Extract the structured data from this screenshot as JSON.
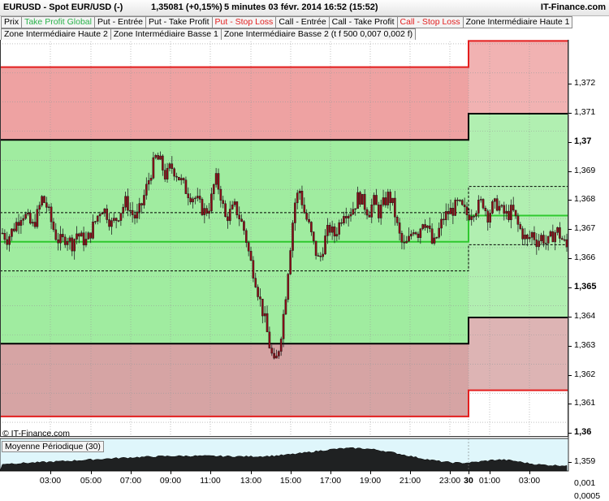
{
  "header": {
    "instrument": "EURUSD - Spot EUR/USD (-)",
    "last": "1,35081 (+0,15%)",
    "period": "5 minutes  03 févr. 2014 16:52 (15:52)",
    "brand": "IT-Finance.com"
  },
  "tabs_row1": [
    {
      "label": "Prix",
      "color": "normal"
    },
    {
      "label": "Take Profit Global",
      "color": "green"
    },
    {
      "label": "Put - Entrée",
      "color": "normal"
    },
    {
      "label": "Put - Take Profit",
      "color": "normal"
    },
    {
      "label": "Put - Stop Loss",
      "color": "red"
    },
    {
      "label": "Call - Entrée",
      "color": "normal"
    },
    {
      "label": "Call - Take Profit",
      "color": "normal"
    },
    {
      "label": "Call - Stop Loss",
      "color": "red"
    },
    {
      "label": "Zone Intermédiaire Haute 1",
      "color": "normal"
    }
  ],
  "tabs_row2": [
    {
      "label": "Zone Intermédiaire Haute 2",
      "color": "normal"
    },
    {
      "label": "Zone Intermédiaire Basse 1",
      "color": "normal"
    },
    {
      "label": "Zone Intermédiaire Basse 2 (t f 500 0,007 0,002 f)",
      "color": "normal"
    }
  ],
  "copyright": "© IT-Finance.com",
  "oscillator": {
    "title": "Moyenne Périodique (30)"
  },
  "colors": {
    "red_zone": "#eea2a2",
    "green_zone": "#a0eca0",
    "dark_red_zone": "#d6a4a4",
    "red_line": "#e31e1e",
    "green_line": "#2ec82e",
    "candle": "#8b0e18",
    "osc_bg": "#dff6fb"
  },
  "chart_data": {
    "type": "candlestick",
    "y_range": [
      1.3585,
      1.3725
    ],
    "y_ticks": [
      {
        "value": 1.359,
        "label": "1,359",
        "bold": false
      },
      {
        "value": 1.36,
        "label": "1,36",
        "bold": true
      },
      {
        "value": 1.361,
        "label": "1,361",
        "bold": false
      },
      {
        "value": 1.362,
        "label": "1,362",
        "bold": false
      },
      {
        "value": 1.363,
        "label": "1,363",
        "bold": false
      },
      {
        "value": 1.364,
        "label": "1,364",
        "bold": false
      },
      {
        "value": 1.365,
        "label": "1,365",
        "bold": true
      },
      {
        "value": 1.366,
        "label": "1,366",
        "bold": false
      },
      {
        "value": 1.367,
        "label": "1,367",
        "bold": false
      },
      {
        "value": 1.368,
        "label": "1,368",
        "bold": false
      },
      {
        "value": 1.369,
        "label": "1,369",
        "bold": false
      },
      {
        "value": 1.37,
        "label": "1,37",
        "bold": true
      },
      {
        "value": 1.371,
        "label": "1,371",
        "bold": false
      },
      {
        "value": 1.372,
        "label": "1,372",
        "bold": false
      }
    ],
    "x_ticks": [
      {
        "label": "03:00",
        "bold": false
      },
      {
        "label": "05:00",
        "bold": false
      },
      {
        "label": "07:00",
        "bold": false
      },
      {
        "label": "09:00",
        "bold": false
      },
      {
        "label": "11:00",
        "bold": false
      },
      {
        "label": "13:00",
        "bold": false
      },
      {
        "label": "15:00",
        "bold": false
      },
      {
        "label": "17:00",
        "bold": false
      },
      {
        "label": "19:00",
        "bold": false
      },
      {
        "label": "21:00",
        "bold": false
      },
      {
        "label": "23:00",
        "bold": false
      },
      {
        "label": "30",
        "bold": true
      },
      {
        "label": "01:00",
        "bold": false
      },
      {
        "label": "03:00",
        "bold": false
      }
    ],
    "levels_prev": {
      "stop_loss_high": 1.3712,
      "entry_high": 1.3687,
      "take_profit": 1.3652,
      "zone_high": 1.3662,
      "zone_low": 1.3642,
      "entry_low": 1.3617,
      "stop_loss_low": 1.3592
    },
    "levels_current": {
      "stop_loss_high": 1.3721,
      "entry_high": 1.3696,
      "take_profit": 1.3661,
      "zone_high": 1.3671,
      "zone_low": 1.3651,
      "entry_low": 1.3626,
      "stop_loss_low": 1.3601
    },
    "price_path": [
      1.3655,
      1.3653,
      1.3656,
      1.3659,
      1.3662,
      1.366,
      1.3657,
      1.3661,
      1.3667,
      1.3664,
      1.3658,
      1.3653,
      1.3652,
      1.3654,
      1.3651,
      1.3655,
      1.3653,
      1.3652,
      1.3656,
      1.366,
      1.3664,
      1.3662,
      1.3658,
      1.366,
      1.3663,
      1.3666,
      1.3662,
      1.366,
      1.3664,
      1.367,
      1.3676,
      1.3681,
      1.3679,
      1.3674,
      1.3678,
      1.3676,
      1.3673,
      1.367,
      1.3668,
      1.3667,
      1.3664,
      1.3662,
      1.3665,
      1.3674,
      1.3669,
      1.366,
      1.3662,
      1.3664,
      1.366,
      1.3655,
      1.3646,
      1.364,
      1.3632,
      1.3625,
      1.3616,
      1.3609,
      1.3617,
      1.363,
      1.3648,
      1.3665,
      1.367,
      1.3662,
      1.3657,
      1.365,
      1.3645,
      1.3652,
      1.3657,
      1.3654,
      1.3658,
      1.3663,
      1.3662,
      1.3664,
      1.3668,
      1.3665,
      1.3662,
      1.3666,
      1.3662,
      1.3665,
      1.3668,
      1.3664,
      1.3655,
      1.365,
      1.3652,
      1.3657,
      1.3655,
      1.366,
      1.3657,
      1.365,
      1.3655,
      1.366,
      1.3662,
      1.3663,
      1.3665,
      1.3663,
      1.3661,
      1.3663,
      1.3664,
      1.3666,
      1.3661,
      1.3664,
      1.3665,
      1.3662,
      1.3661,
      1.3663,
      1.3658,
      1.3655,
      1.3652,
      1.3655,
      1.3652,
      1.3654,
      1.3651,
      1.3654,
      1.3656,
      1.3653,
      1.365
    ],
    "oscillator_range": [
      0,
      0.0012
    ],
    "oscillator_ticks": [
      {
        "value": 0.001,
        "label": "0,001"
      },
      {
        "value": 0.0005,
        "label": "0,0005"
      }
    ]
  }
}
